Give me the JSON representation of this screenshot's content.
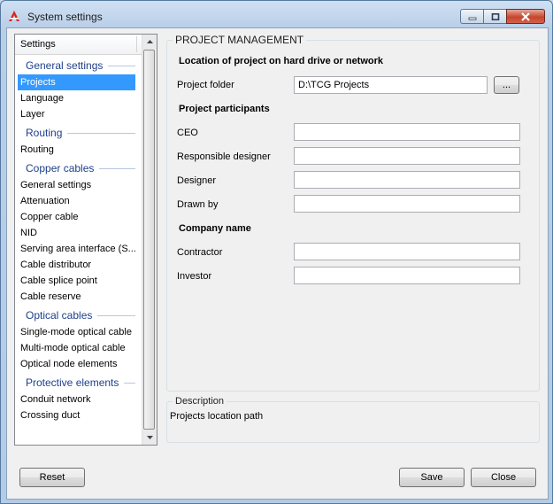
{
  "window": {
    "title": "System settings"
  },
  "sidebar": {
    "header": "Settings",
    "sections": [
      {
        "title": "General settings",
        "items": [
          "Projects",
          "Language",
          "Layer"
        ]
      },
      {
        "title": "Routing",
        "items": [
          "Routing"
        ]
      },
      {
        "title": "Copper cables",
        "items": [
          "General settings",
          "Attenuation",
          "Copper cable",
          "NID",
          "Serving area interface (S...",
          "Cable distributor",
          "Cable splice point",
          "Cable reserve"
        ]
      },
      {
        "title": "Optical cables",
        "items": [
          "Single-mode optical cable",
          "Multi-mode optical cable",
          "Optical node elements"
        ]
      },
      {
        "title": "Protective elements",
        "items": [
          "Conduit network",
          "Crossing duct"
        ]
      }
    ],
    "selected": "Projects"
  },
  "project": {
    "group_title": "PROJECT  MANAGEMENT",
    "location_heading": "Location of project on hard drive or network",
    "folder_label": "Project folder",
    "folder_value": "D:\\TCG Projects",
    "browse_label": "...",
    "participants_heading": "Project participants",
    "ceo_label": "CEO",
    "ceo_value": "",
    "responsible_label": "Responsible designer",
    "responsible_value": "",
    "designer_label": "Designer",
    "designer_value": "",
    "drawn_label": "Drawn by",
    "drawn_value": "",
    "company_heading": "Company name",
    "contractor_label": "Contractor",
    "contractor_value": "",
    "investor_label": "Investor",
    "investor_value": ""
  },
  "description": {
    "title": "Description",
    "text": "Projects location path"
  },
  "buttons": {
    "reset": "Reset",
    "save": "Save",
    "close": "Close"
  },
  "colors": {
    "selection": "#3399ff",
    "group_heading": "#1e3f8c",
    "close_button": "#c8452e"
  }
}
